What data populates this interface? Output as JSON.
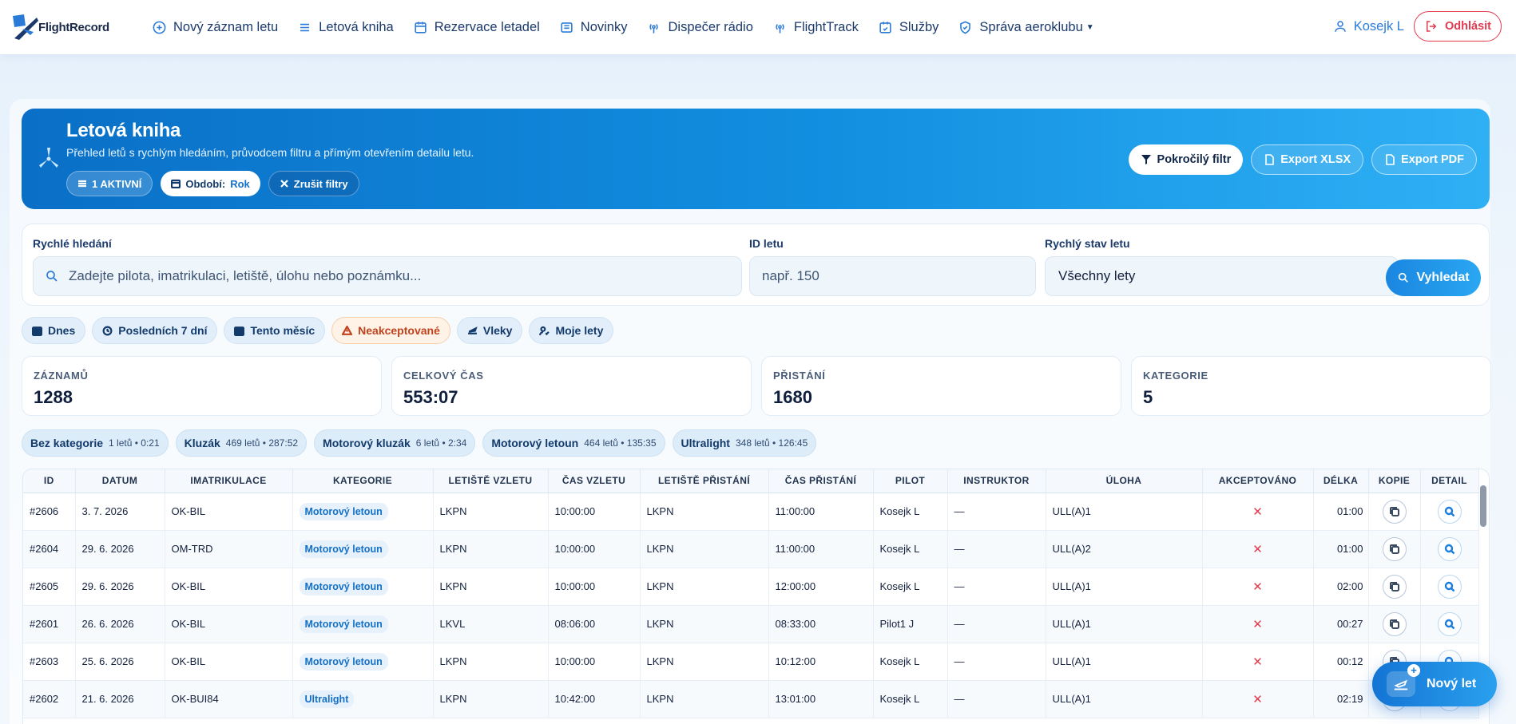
{
  "brand": {
    "name": "FlightRecord"
  },
  "nav": {
    "items": [
      {
        "label": "Nový záznam letu",
        "icon": "plus-circle-icon"
      },
      {
        "label": "Letová kniha",
        "icon": "list-icon"
      },
      {
        "label": "Rezervace letadel",
        "icon": "calendar-icon"
      },
      {
        "label": "Novinky",
        "icon": "newspaper-icon"
      },
      {
        "label": "Dispečer rádio",
        "icon": "radio-icon"
      },
      {
        "label": "FlightTrack",
        "icon": "radio-icon"
      },
      {
        "label": "Služby",
        "icon": "calendar-check-icon"
      },
      {
        "label": "Správa aeroklubu",
        "icon": "shield-icon"
      }
    ],
    "user": "Kosejk L",
    "logout": "Odhlásit"
  },
  "hero": {
    "title": "Letová kniha",
    "subtitle": "Přehled letů s rychlým hledáním, průvodcem filtru a přímým otevřením detailu letu.",
    "active_chip": "1 AKTIVNÍ",
    "period_label": "Období:",
    "period_value": "Rok",
    "clear_chip": "Zrušit filtry",
    "advanced_filter": "Pokročilý filtr",
    "export_xlsx": "Export XLSX",
    "export_pdf": "Export PDF"
  },
  "search": {
    "quick_label": "Rychlé hledání",
    "quick_placeholder": "Zadejte pilota, imatrikulaci, letiště, úlohu nebo poznámku...",
    "id_label": "ID letu",
    "id_placeholder": "např. 150",
    "status_label": "Rychlý stav letu",
    "status_value": "Všechny lety",
    "button": "Vyhledat"
  },
  "quick_filters": [
    {
      "label": "Dnes",
      "icon": "calendar-icon"
    },
    {
      "label": "Posledních 7 dní",
      "icon": "history-icon"
    },
    {
      "label": "Tento měsíc",
      "icon": "calendar-icon"
    },
    {
      "label": "Neakceptované",
      "icon": "warning-icon"
    },
    {
      "label": "Vleky",
      "icon": "plane-icon"
    },
    {
      "label": "Moje lety",
      "icon": "user-check-icon"
    }
  ],
  "stats": [
    {
      "label": "ZÁZNAMŮ",
      "value": "1288"
    },
    {
      "label": "CELKOVÝ ČAS",
      "value": "553:07"
    },
    {
      "label": "PŘISTÁNÍ",
      "value": "1680"
    },
    {
      "label": "KATEGORIE",
      "value": "5"
    }
  ],
  "categories": [
    {
      "name": "Bez kategorie",
      "meta": "1 letů • 0:21"
    },
    {
      "name": "Kluzák",
      "meta": "469 letů • 287:52"
    },
    {
      "name": "Motorový kluzák",
      "meta": "6 letů • 2:34"
    },
    {
      "name": "Motorový letoun",
      "meta": "464 letů • 135:35"
    },
    {
      "name": "Ultralight",
      "meta": "348 letů • 126:45"
    }
  ],
  "table": {
    "headers": [
      "ID",
      "DATUM",
      "IMATRIKULACE",
      "KATEGORIE",
      "LETIŠTĚ VZLETU",
      "ČAS VZLETU",
      "LETIŠTĚ PŘISTÁNÍ",
      "ČAS PŘISTÁNÍ",
      "PILOT",
      "INSTRUKTOR",
      "ÚLOHA",
      "AKCEPTOVÁNO",
      "DÉLKA",
      "KOPIE",
      "DETAIL"
    ],
    "rows": [
      {
        "id": "#2606",
        "date": "3. 7. 2026",
        "reg": "OK-BIL",
        "cat": "Motorový letoun",
        "from": "LKPN",
        "dep": "10:00:00",
        "to": "LKPN",
        "arr": "11:00:00",
        "pilot": "Kosejk L",
        "instr": "—",
        "task": "ULL(A)1",
        "acc": "✕",
        "len": "01:00"
      },
      {
        "id": "#2604",
        "date": "29. 6. 2026",
        "reg": "OM-TRD",
        "cat": "Motorový letoun",
        "from": "LKPN",
        "dep": "10:00:00",
        "to": "LKPN",
        "arr": "11:00:00",
        "pilot": "Kosejk L",
        "instr": "—",
        "task": "ULL(A)2",
        "acc": "✕",
        "len": "01:00"
      },
      {
        "id": "#2605",
        "date": "29. 6. 2026",
        "reg": "OK-BIL",
        "cat": "Motorový letoun",
        "from": "LKPN",
        "dep": "10:00:00",
        "to": "LKPN",
        "arr": "12:00:00",
        "pilot": "Kosejk L",
        "instr": "—",
        "task": "ULL(A)1",
        "acc": "✕",
        "len": "02:00"
      },
      {
        "id": "#2601",
        "date": "26. 6. 2026",
        "reg": "OK-BIL",
        "cat": "Motorový letoun",
        "from": "LKVL",
        "dep": "08:06:00",
        "to": "LKPN",
        "arr": "08:33:00",
        "pilot": "Pilot1 J",
        "instr": "—",
        "task": "ULL(A)1",
        "acc": "✕",
        "len": "00:27"
      },
      {
        "id": "#2603",
        "date": "25. 6. 2026",
        "reg": "OK-BIL",
        "cat": "Motorový letoun",
        "from": "LKPN",
        "dep": "10:00:00",
        "to": "LKPN",
        "arr": "10:12:00",
        "pilot": "Kosejk L",
        "instr": "—",
        "task": "ULL(A)1",
        "acc": "✕",
        "len": "00:12"
      },
      {
        "id": "#2602",
        "date": "21. 6. 2026",
        "reg": "OK-BUI84",
        "cat": "Ultralight",
        "from": "LKPN",
        "dep": "10:42:00",
        "to": "LKPN",
        "arr": "13:01:00",
        "pilot": "Kosejk L",
        "instr": "—",
        "task": "ULL(A)1",
        "acc": "✕",
        "len": "02:19"
      }
    ]
  },
  "fab": {
    "label": "Nový let"
  },
  "colors": {
    "primary": "#1a86e0",
    "danger": "#e23b4e",
    "hero_start": "#0a6fc7",
    "hero_end": "#2fb0f5"
  }
}
